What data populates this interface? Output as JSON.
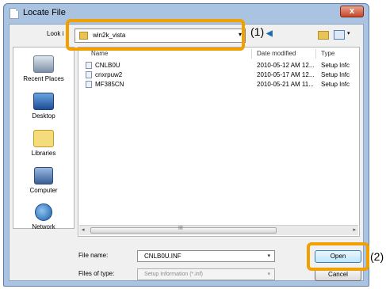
{
  "window": {
    "title": "Locate File",
    "close_label": "x"
  },
  "lookin": {
    "label": "Look i",
    "value": "win2k_vista",
    "arrow": "▾"
  },
  "callouts": {
    "one": "(1)",
    "two": "(2)",
    "accent": "#f2a000"
  },
  "toolbar": {
    "up_glyph": "◀",
    "view_arrow": "▾"
  },
  "places": [
    {
      "label": "Recent Places",
      "icon": "recent-places-icon"
    },
    {
      "label": "Desktop",
      "icon": "desktop-icon"
    },
    {
      "label": "Libraries",
      "icon": "libraries-icon"
    },
    {
      "label": "Computer",
      "icon": "computer-icon"
    },
    {
      "label": "Network",
      "icon": "network-icon"
    }
  ],
  "filelist": {
    "columns": [
      "Name",
      "Date modified",
      "Type"
    ],
    "rows": [
      {
        "name": "CNLB0U",
        "date": "2010-05-12 AM 12...",
        "type": "Setup Infc"
      },
      {
        "name": "cnxrpuw2",
        "date": "2010-05-17 AM 12...",
        "type": "Setup Infc"
      },
      {
        "name": "MF385CN",
        "date": "2010-05-21 AM 11...",
        "type": "Setup Infc"
      }
    ],
    "scroll_left": "◂",
    "scroll_right": "▸",
    "scroll_grip": "III"
  },
  "filename": {
    "label": "File name:",
    "value": "CNLB0U.INF",
    "arrow": "▾"
  },
  "filetype": {
    "label": "Files of type:",
    "value": "Setup Information (*.inf)",
    "arrow": "▾"
  },
  "buttons": {
    "open": "Open",
    "cancel": "Cancel"
  }
}
